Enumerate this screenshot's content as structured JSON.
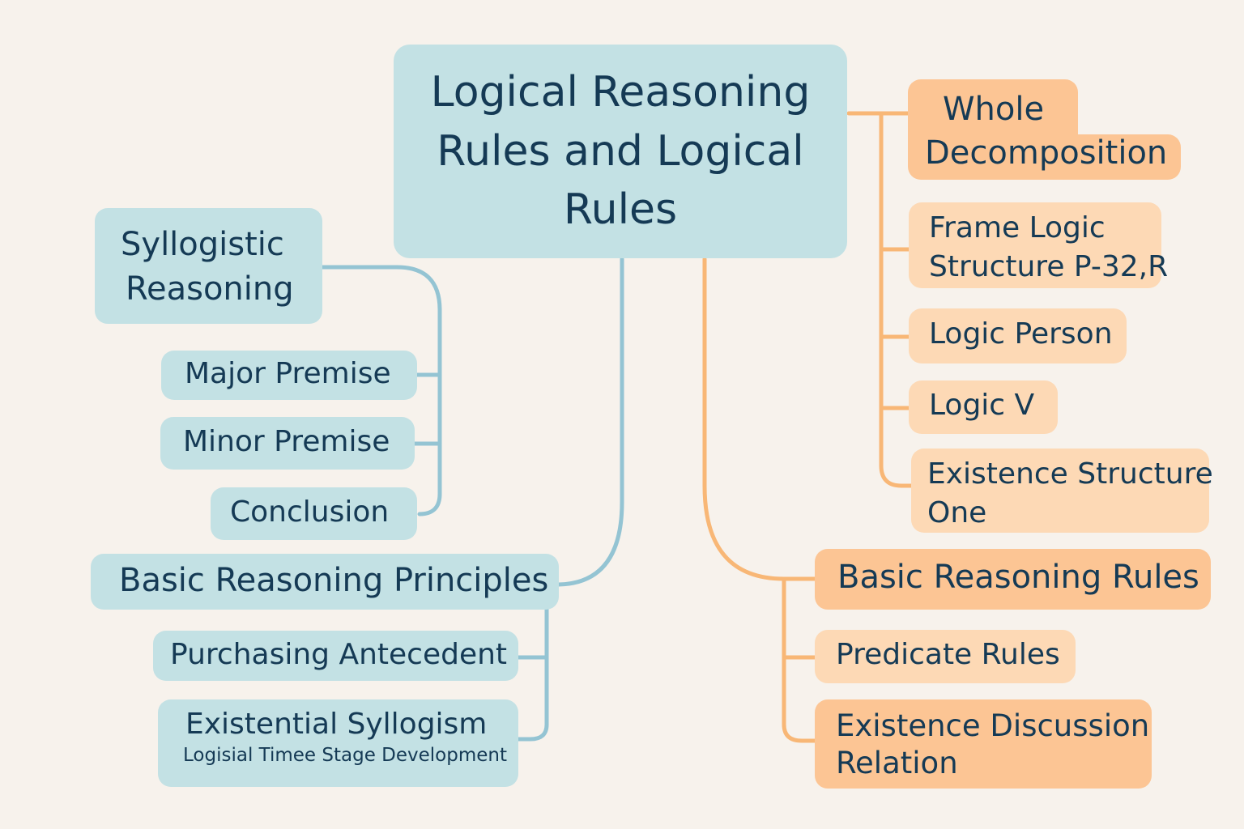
{
  "root": {
    "lines": [
      "Logical Reasoning",
      "Rules and Logical",
      "Rules"
    ]
  },
  "left": {
    "syllogistic": {
      "lines": [
        "Syllogistic",
        "Reasoning"
      ]
    },
    "major_premise": "Major Premise",
    "minor_premise": "Minor Premise",
    "conclusion": "Conclusion",
    "basic_principles": "Basic Reasoning Principles",
    "purchasing_antecedent": "Purchasing Antecedent",
    "existential_syllogism": "Existential Syllogism",
    "existential_sub": "Logisial Timee Stage Development"
  },
  "right": {
    "whole_decomposition": {
      "lines": [
        "Whole",
        "Decomposition"
      ]
    },
    "frame_logic": {
      "lines": [
        "Frame Logic",
        "Structure P-32,R"
      ]
    },
    "logic_person": "Logic Person",
    "logic_v": "Logic V",
    "existence_structure": {
      "lines": [
        "Existence Structure",
        "One"
      ]
    },
    "basic_rules": "Basic Reasoning Rules",
    "predicate_rules": "Predicate Rules",
    "existence_discussion": {
      "lines": [
        "Existence Discussion",
        "Relation"
      ]
    }
  },
  "colors": {
    "blue_node": "#c3e1e4",
    "blue_line": "#94c4d3",
    "orange_node": "#fcc594",
    "orange_line": "#f8b776",
    "text": "#153a55",
    "background": "#f7f2ec"
  }
}
